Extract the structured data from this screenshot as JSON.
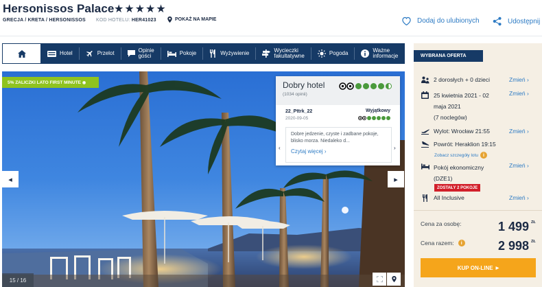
{
  "hotel": {
    "name": "Hersonissos Palace",
    "stars": "★★★★★",
    "breadcrumb": "GRECJA / KRETA / HERSONISSOS",
    "code_label": "KOD HOTELU:",
    "code_value": "HER41023",
    "map_label": "POKAŻ NA MAPIE"
  },
  "actions": {
    "favorite_label": "Dodaj do ulubionych",
    "share_label": "Udostępnij"
  },
  "nav": {
    "items": [
      {
        "label": "Hotel",
        "icon": "hotel-icon"
      },
      {
        "label": "Przelot",
        "icon": "plane-icon"
      },
      {
        "label": "Opinie\ngości",
        "icon": "chat-icon"
      },
      {
        "label": "Pokoje",
        "icon": "bed-icon"
      },
      {
        "label": "Wyżywienie",
        "icon": "cutlery-icon"
      },
      {
        "label": "Wycieczki\nfakultatywne",
        "icon": "signpost-icon"
      },
      {
        "label": "Pogoda",
        "icon": "sun-icon"
      },
      {
        "label": "Ważne\ninformacje",
        "icon": "info-icon"
      }
    ]
  },
  "gallery": {
    "promo": "5% ZALICZKI LATO FIRST MINUTE",
    "counter": "15 / 16"
  },
  "tripadvisor": {
    "rating_text": "Dobry hotel",
    "reviews_count": "(1034 opinii)",
    "rating_bubbles": 4.5,
    "review": {
      "user": "22_Pttrk_22",
      "date": "2020-09-05",
      "verdict": "Wyjątkowy",
      "bubbles": 5,
      "text": "Dobre jedzenie, czyste i zadbane pokoje, blisko morza. Niedaleko d...",
      "more": "Czytaj więcej"
    }
  },
  "offer": {
    "heading": "WYBRANA OFERTA",
    "change_label": "Zmień",
    "travelers": "2 dorosłych + 0 dzieci",
    "dates_line1": "25 kwietnia 2021 - 02",
    "dates_line2": "maja 2021",
    "nights": "(7 noclegów)",
    "departure": "Wylot: Wrocław 21:55",
    "return": "Powrót: Heraklion 19:15",
    "flight_details": "Zobacz szczegóły lotu",
    "room_line1": "Pokój ekonomiczny",
    "room_line2": "(DZE1)",
    "rooms_left": "ZOSTAŁY 2 POKOJE",
    "board": "All Inclusive",
    "price_person_label": "Cena za osobę:",
    "price_person": "1 499",
    "price_total_label": "Cena razem:",
    "price_total": "2 998",
    "currency": "ZŁ",
    "buy_label": "KUP ON-LINE"
  }
}
